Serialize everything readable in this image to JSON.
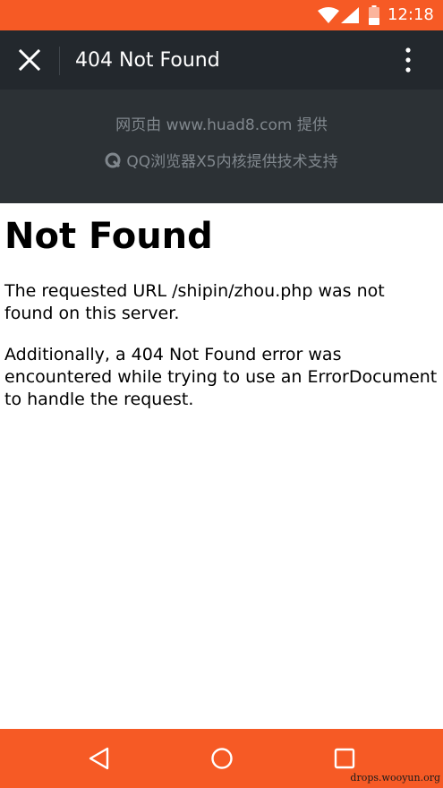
{
  "status_bar": {
    "time": "12:18",
    "icons": [
      "wifi-icon",
      "signal-icon",
      "battery-icon"
    ],
    "color": "#f65a25"
  },
  "app_bar": {
    "title": "404 Not Found",
    "close_icon": "close-icon",
    "menu_icon": "more-vert-icon",
    "color": "#23282d"
  },
  "banner": {
    "provider_text": "网页由 www.huad8.com 提供",
    "x5_text": "QQ浏览器X5内核提供技术支持",
    "x5_icon": "qq-browser-icon",
    "color": "#2c3135"
  },
  "content": {
    "heading": "Not Found",
    "paragraph1": "The requested URL /shipin/zhou.php was not found on this server.",
    "paragraph2": "Additionally, a 404 Not Found error was encountered while trying to use an ErrorDocument to handle the request."
  },
  "nav_bar": {
    "icons": [
      "back-icon",
      "home-icon",
      "recent-apps-icon"
    ],
    "color": "#f65a25"
  },
  "watermark": "drops.wooyun.org"
}
